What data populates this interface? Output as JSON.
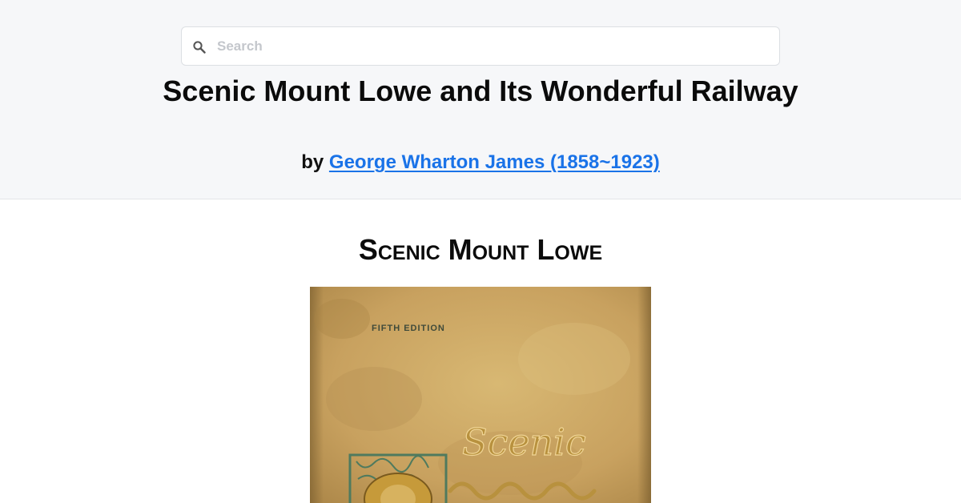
{
  "search": {
    "placeholder": "Search",
    "icon": "search-icon"
  },
  "book": {
    "title": "Scenic Mount Lowe and Its Wonderful Railway",
    "by_label": "by",
    "author": "George Wharton James (1858~1923)"
  },
  "content": {
    "heading": "Scenic Mount Lowe",
    "cover": {
      "edition_text": "FIFTH EDITION",
      "script_text": "Scenic",
      "icon": "book-cover-image"
    }
  },
  "colors": {
    "header_bg": "#f6f7f9",
    "link": "#1a73e8",
    "cover_base": "#c9a463"
  }
}
